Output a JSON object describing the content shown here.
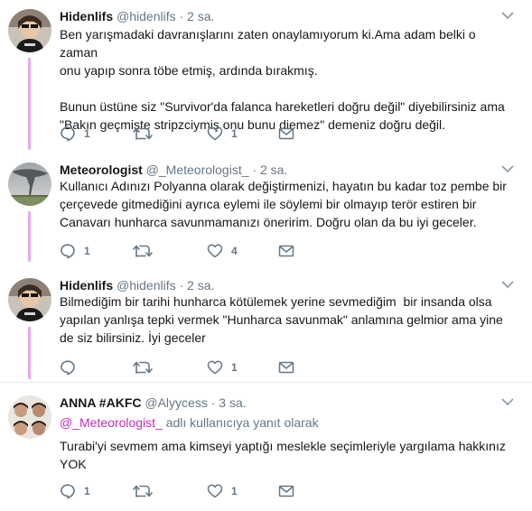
{
  "tweets": [
    {
      "name": "Hidenlifs",
      "handle": "@hidenlifs",
      "separator": "·",
      "time": "2 sa.",
      "text": "Ben yarışmadaki davranışlarını zaten onaylamıyorum ki.Ama adam belki o zaman\nonu yapıp sonra töbe etmiş, ardında bırakmış.\n\nBunun üstüne siz \"Survivor'da falanca hareketleri doğru değil\" diyebilirsiniz ama\n\"Bakın geçmişte stripzciymiş onu bunu diemez\" demeniz doğru değil.",
      "replies": "1",
      "retweets": "",
      "likes": "1",
      "avatar_icon": "person-avatar-icon"
    },
    {
      "name": "Meteorologist",
      "handle": "@_Meteorologist_",
      "separator": "·",
      "time": "2 sa.",
      "text": "Kullanıcı Adınızı Polyanna olarak değiştirmenizi, hayatın bu kadar toz pembe bir\nçerçevede gitmediğini ayrıca eylemi ile söylemi bir olmayıp terör estiren bir\nCanavarı hunharca savunmamanızı öneririm. Doğru olan da bu iyi geceler.",
      "replies": "1",
      "retweets": "",
      "likes": "4",
      "avatar_icon": "tornado-avatar-icon"
    },
    {
      "name": "Hidenlifs",
      "handle": "@hidenlifs",
      "separator": "·",
      "time": "2 sa.",
      "text": "Bilmediğim bir tarihi hunharca kötülemek yerine sevmediğim  bir insanda olsa\nyapılan yanlışa tepki vermek \"Hunharca savunmak\" anlamına gelmior ama yine\nde siz bilirsiniz. İyi geceler",
      "replies": "",
      "retweets": "",
      "likes": "1",
      "avatar_icon": "person-avatar-icon"
    },
    {
      "name": "ANNA #AKFC",
      "handle": "@Alyycess",
      "separator": "·",
      "time": "3 sa.",
      "reply_mention": "@_Meteorologist_",
      "reply_suffix": " adlı kullanıcıya yanıt olarak",
      "text": "Turabi'yi sevmem ama kimseyi yaptığı meslekle seçimleriyle yargılama hakkınız\nYOK",
      "replies": "1",
      "retweets": "",
      "likes": "1",
      "avatar_icon": "group-avatar-icon"
    }
  ],
  "colors": {
    "thread_line": "#e9a9ef",
    "mention": "#c42bbd",
    "secondary_text": "#657786",
    "divider": "#e6ecf0"
  }
}
